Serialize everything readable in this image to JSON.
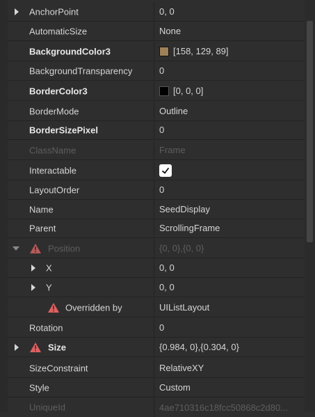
{
  "properties": {
    "anchor_point": {
      "name": "AnchorPoint",
      "value": "0, 0"
    },
    "automatic_size": {
      "name": "AutomaticSize",
      "value": "None"
    },
    "background_color": {
      "name": "BackgroundColor3",
      "value": "[158, 129, 89]",
      "swatch": "#9e8159"
    },
    "background_transparency": {
      "name": "BackgroundTransparency",
      "value": "0"
    },
    "border_color": {
      "name": "BorderColor3",
      "value": "[0, 0, 0]",
      "swatch": "#000000"
    },
    "border_mode": {
      "name": "BorderMode",
      "value": "Outline"
    },
    "border_size": {
      "name": "BorderSizePixel",
      "value": "0"
    },
    "class_name": {
      "name": "ClassName",
      "value": "Frame"
    },
    "interactable": {
      "name": "Interactable",
      "checked": true
    },
    "layout_order": {
      "name": "LayoutOrder",
      "value": "0"
    },
    "name": {
      "name": "Name",
      "value": "SeedDisplay"
    },
    "parent": {
      "name": "Parent",
      "value": "ScrollingFrame"
    },
    "position": {
      "name": "Position",
      "value": "{0, 0},{0, 0}"
    },
    "position_x": {
      "name": "X",
      "value": "0, 0"
    },
    "position_y": {
      "name": "Y",
      "value": "0, 0"
    },
    "overridden": {
      "name": "Overridden by",
      "value": "UIListLayout"
    },
    "rotation": {
      "name": "Rotation",
      "value": "0"
    },
    "size": {
      "name": "Size",
      "value": "{0.984, 0},{0.304, 0}"
    },
    "size_constraint": {
      "name": "SizeConstraint",
      "value": "RelativeXY"
    },
    "style": {
      "name": "Style",
      "value": "Custom"
    },
    "unique_id": {
      "name": "UniqueId",
      "value": "4ae710316c18fcc50868c2d80..."
    }
  },
  "colors": {
    "warning": "#e06060",
    "panel": "#2e2e2e"
  }
}
